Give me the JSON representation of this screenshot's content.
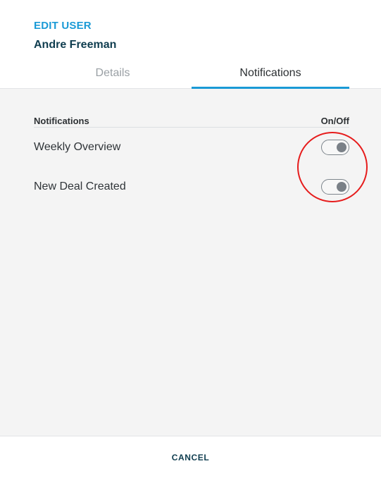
{
  "colors": {
    "accent": "#1a9ad6",
    "title_dark": "#0f3d4f",
    "highlight": "#e61c1c"
  },
  "header": {
    "eyebrow": "EDIT USER",
    "user_name": "Andre Freeman"
  },
  "tabs": [
    {
      "label": "Details",
      "active": false
    },
    {
      "label": "Notifications",
      "active": true
    }
  ],
  "notifications": {
    "column_label": "Notifications",
    "toggle_column_label": "On/Off",
    "items": [
      {
        "label": "Weekly Overview",
        "toggle_icon": "toggle-switch-icon",
        "enabled": true
      },
      {
        "label": "New Deal Created",
        "toggle_icon": "toggle-switch-icon",
        "enabled": true
      }
    ]
  },
  "footer": {
    "cancel_label": "CANCEL"
  }
}
